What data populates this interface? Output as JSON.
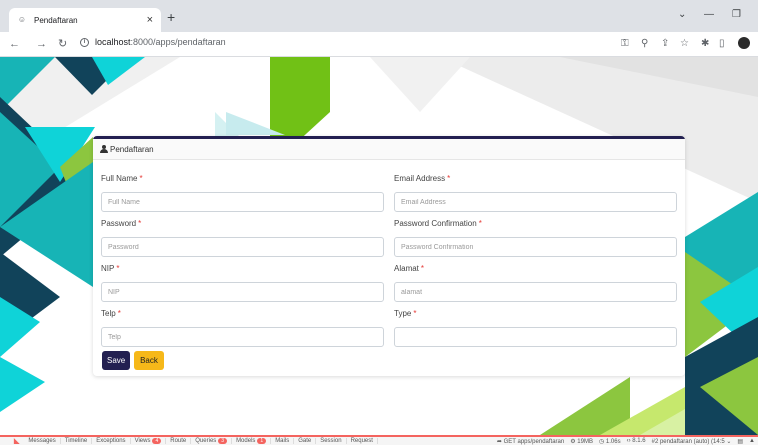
{
  "browser": {
    "tab_title": "Pendaftaran",
    "tab_close": "×",
    "new_tab": "+",
    "url_host": "localhost",
    "url_path": ":8000/apps/pendaftaran"
  },
  "form": {
    "header": "Pendaftaran",
    "required_mark": "*",
    "fields": [
      {
        "label": "Full Name",
        "placeholder": "Full Name",
        "value": ""
      },
      {
        "label": "Email Address",
        "placeholder": "Email Address",
        "value": ""
      },
      {
        "label": "Password",
        "placeholder": "Password",
        "value": ""
      },
      {
        "label": "Password Confirmation",
        "placeholder": "Password Confirmation",
        "value": ""
      },
      {
        "label": "NIP",
        "placeholder": "NIP",
        "value": ""
      },
      {
        "label": "Alamat",
        "placeholder": "alamat",
        "value": ""
      },
      {
        "label": "Telp",
        "placeholder": "Telp",
        "value": ""
      },
      {
        "label": "Type",
        "placeholder": "",
        "value": ""
      }
    ],
    "save_label": "Save",
    "back_label": "Back"
  },
  "debugbar": {
    "tabs": [
      {
        "label": "Messages"
      },
      {
        "label": "Timeline"
      },
      {
        "label": "Exceptions"
      },
      {
        "label": "Views",
        "badge": "4"
      },
      {
        "label": "Route"
      },
      {
        "label": "Queries",
        "badge": "3"
      },
      {
        "label": "Models",
        "badge": "1"
      },
      {
        "label": "Mails"
      },
      {
        "label": "Gate"
      },
      {
        "label": "Session"
      },
      {
        "label": "Request"
      }
    ],
    "request": "GET apps/pendaftaran",
    "memory": "19MB",
    "time": "1.06s",
    "php": "8.1.6",
    "history": "#2 pendaftaran (auto) (14:5"
  },
  "colors": {
    "primary": "#232051",
    "warning": "#f6b819",
    "teal": "#17b4b6",
    "lime": "#8cc63f",
    "navy": "#11435a"
  }
}
